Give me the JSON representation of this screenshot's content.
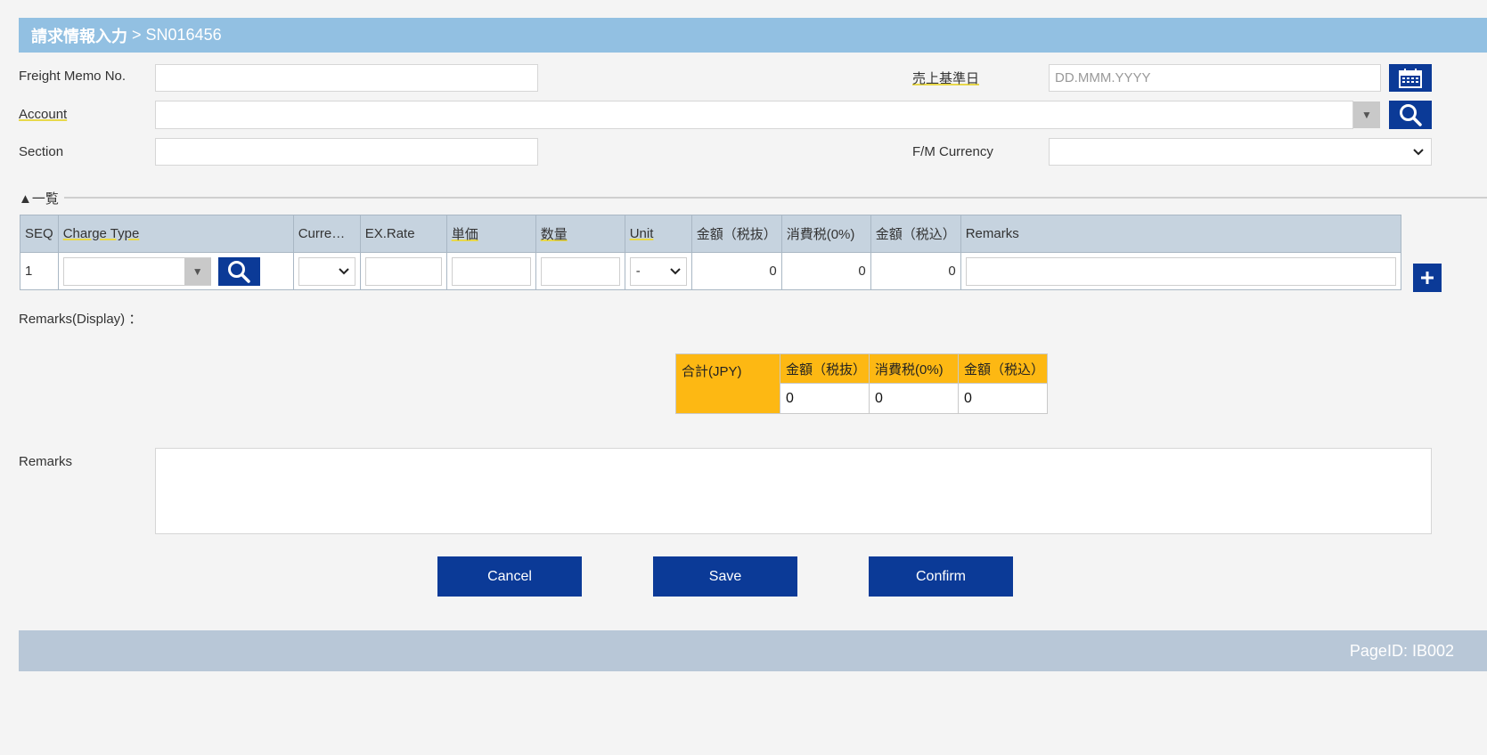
{
  "header": {
    "title": "請求情報入力",
    "separator": " > ",
    "id": "SN016456"
  },
  "form": {
    "freight_memo_label": "Freight Memo No.",
    "freight_memo_value": "",
    "sales_date_label": "売上基準日",
    "sales_date_placeholder": "DD.MMM.YYYY",
    "account_label": "Account",
    "account_value": "",
    "section_label": "Section",
    "section_value": "",
    "currency_label": "F/M Currency",
    "currency_value": ""
  },
  "list": {
    "section_title": "▲一覧",
    "columns": [
      "SEQ",
      "Charge Type",
      "Curre…",
      "EX.Rate",
      "単価",
      "数量",
      "Unit",
      "金額（税抜）",
      "消費税(0%)",
      "金額（税込）",
      "Remarks"
    ],
    "rows": [
      {
        "seq": "1",
        "charge_type": "",
        "currency": "",
        "ex_rate": "",
        "unit_price": "",
        "quantity": "",
        "unit": "-",
        "amount_ex": "0",
        "tax": "0",
        "amount_in": "0",
        "remarks": ""
      }
    ]
  },
  "remarks_display_label": "Remarks(Display) ：",
  "totals": {
    "label": "合計(JPY)",
    "columns": [
      "金額（税抜）",
      "消費税(0%)",
      "金額（税込）"
    ],
    "values": [
      "0",
      "0",
      "0"
    ]
  },
  "remarks_label": "Remarks",
  "remarks_value": "",
  "actions": {
    "cancel": "Cancel",
    "save": "Save",
    "confirm": "Confirm"
  },
  "footer": {
    "page_id": "PageID: IB002"
  },
  "colors": {
    "header": "#92c0e2",
    "button": "#0b3a97",
    "totals_header": "#fdb813",
    "footer": "#b8c7d7"
  },
  "icons": {
    "calendar": "calendar-icon",
    "search": "search-icon",
    "add": "plus-icon",
    "dropdown": "chevron-down-icon"
  }
}
